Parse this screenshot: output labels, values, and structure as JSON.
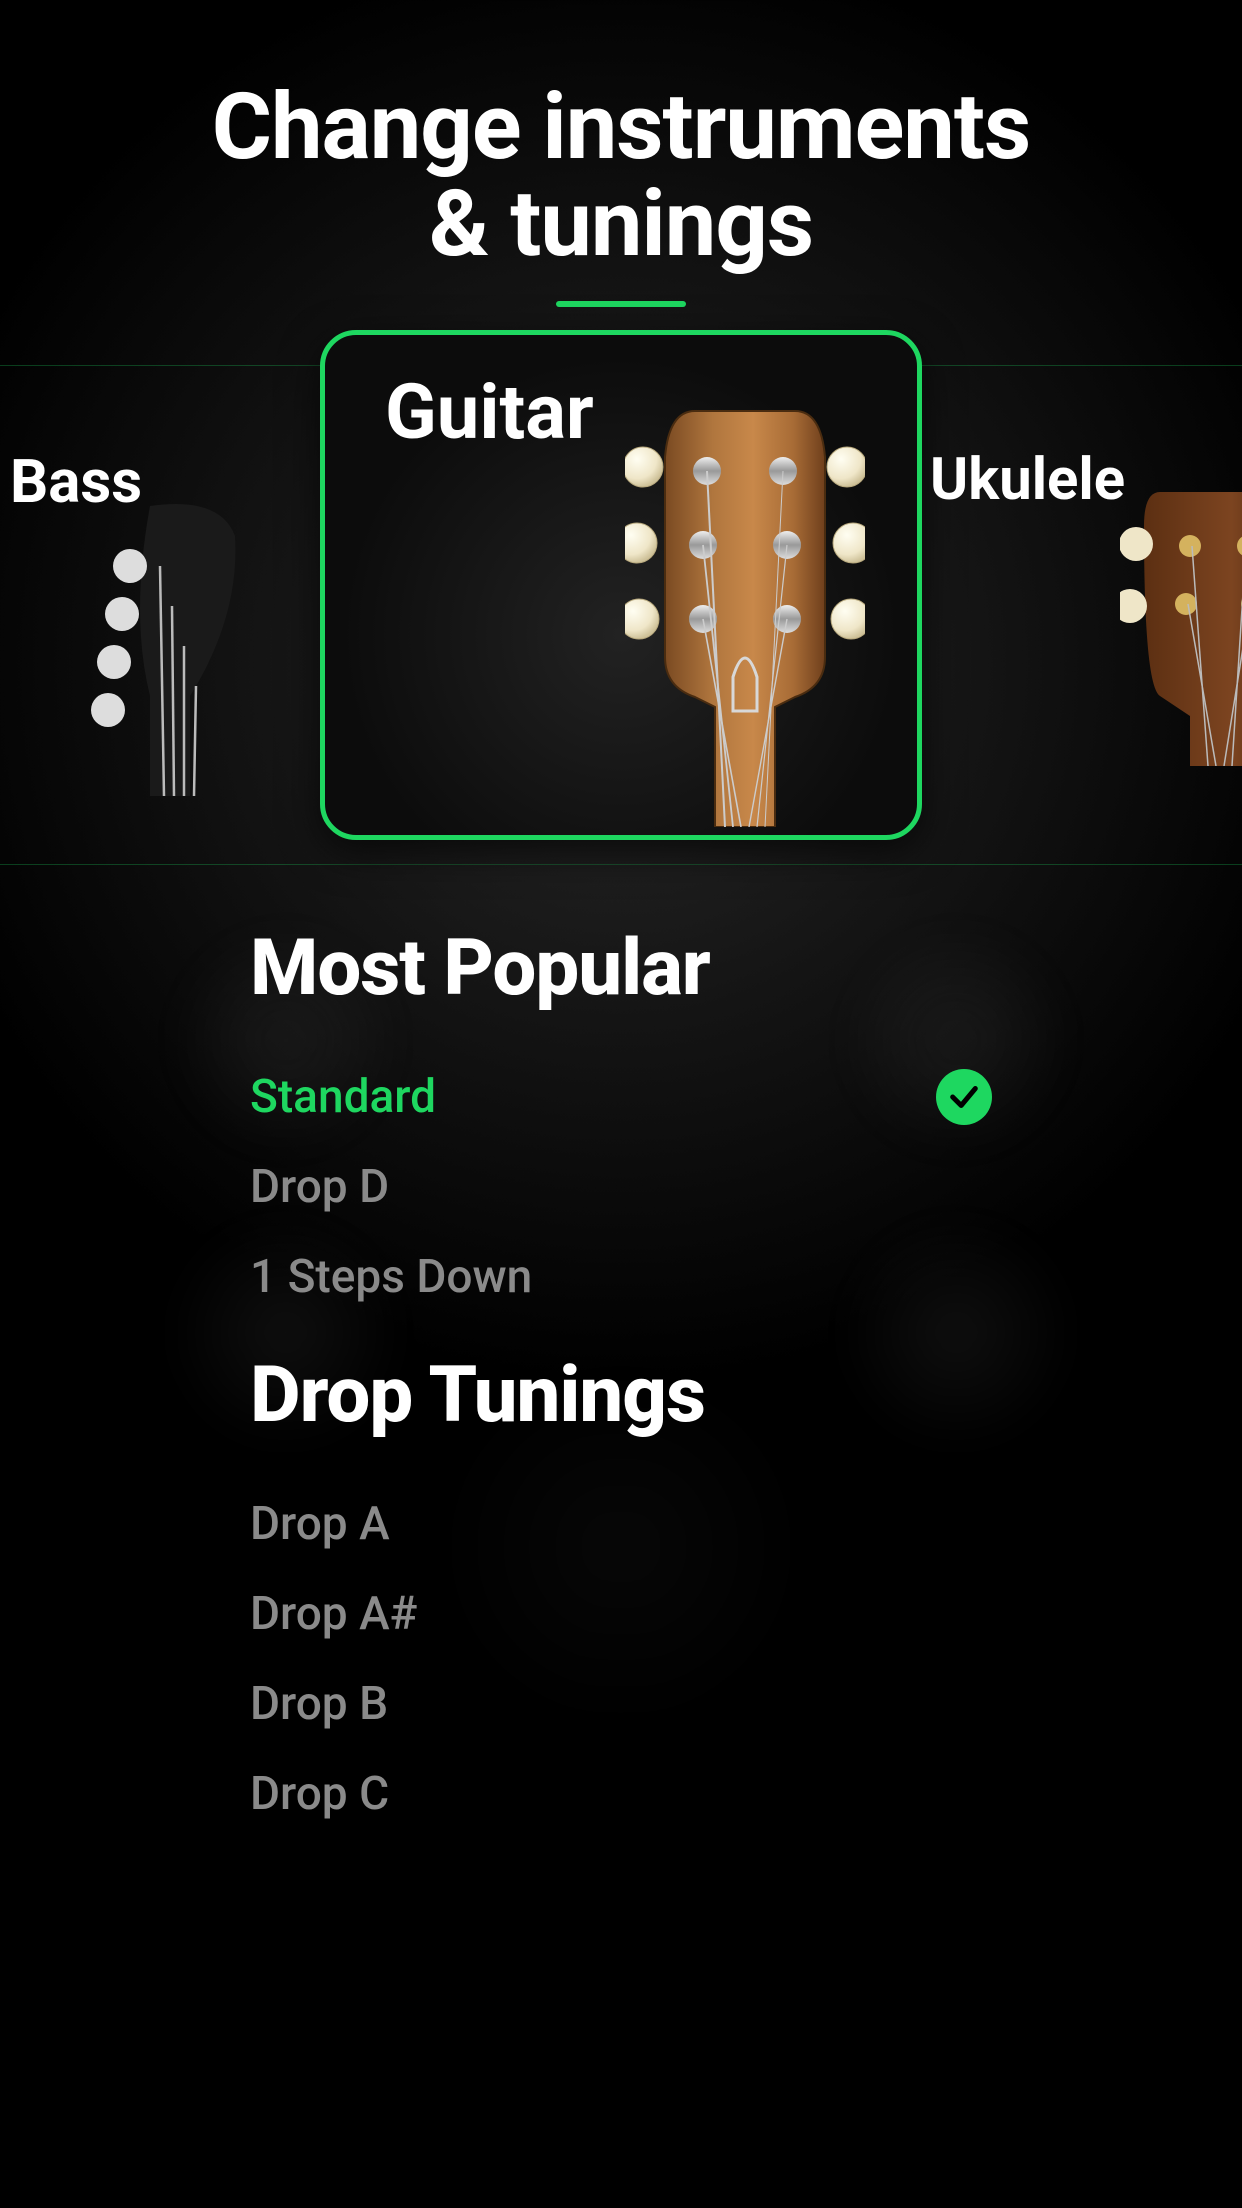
{
  "title_line1": "Change instruments",
  "title_line2": "& tunings",
  "colors": {
    "accent": "#1ed760"
  },
  "instruments": {
    "prev": {
      "name": "Bass"
    },
    "current": {
      "name": "Guitar"
    },
    "next": {
      "name": "Ukulele"
    }
  },
  "sections": [
    {
      "title": "Most Popular",
      "items": [
        {
          "name": "Standard",
          "selected": true
        },
        {
          "name": "Drop D",
          "selected": false
        },
        {
          "name": "1 Steps Down",
          "selected": false
        }
      ]
    },
    {
      "title": "Drop Tunings",
      "items": [
        {
          "name": "Drop A",
          "selected": false
        },
        {
          "name": "Drop A#",
          "selected": false
        },
        {
          "name": "Drop B",
          "selected": false
        },
        {
          "name": "Drop C",
          "selected": false
        }
      ]
    }
  ]
}
